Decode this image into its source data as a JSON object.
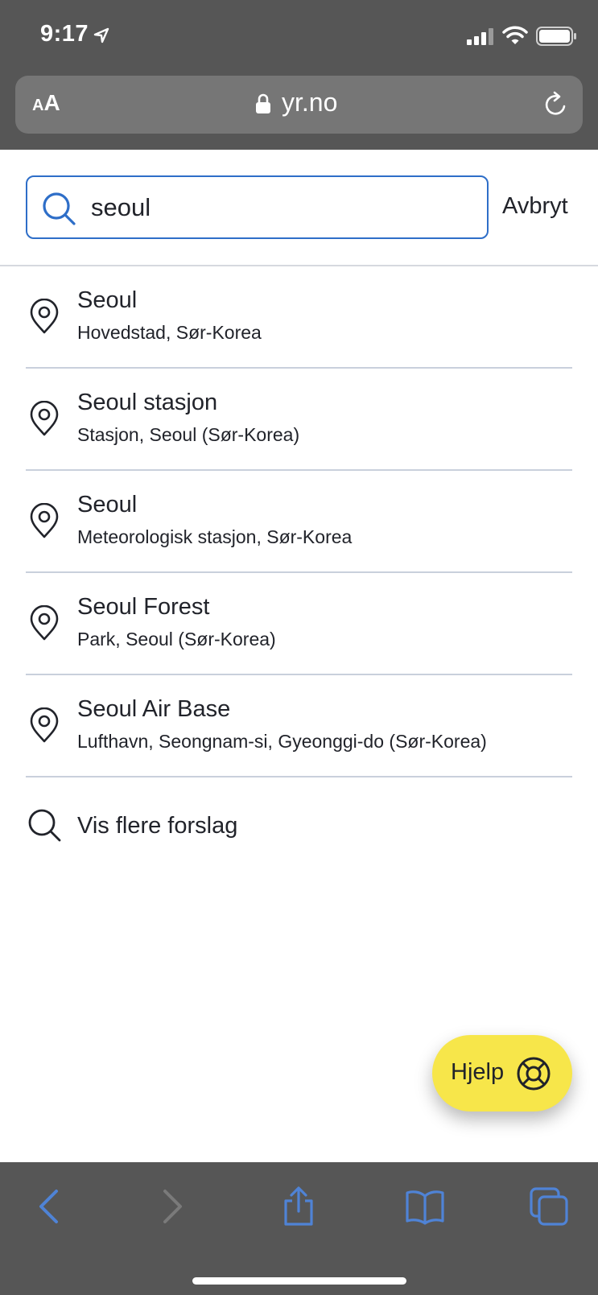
{
  "status_bar": {
    "time": "9:17"
  },
  "browser": {
    "text_size_small": "A",
    "text_size_big": "A",
    "url": "yr.no"
  },
  "search": {
    "value": "seoul",
    "cancel_label": "Avbryt"
  },
  "results": [
    {
      "title": "Seoul",
      "subtitle": "Hovedstad, Sør-Korea"
    },
    {
      "title": "Seoul stasjon",
      "subtitle": "Stasjon, Seoul (Sør-Korea)"
    },
    {
      "title": "Seoul",
      "subtitle": "Meteorologisk stasjon, Sør-Korea"
    },
    {
      "title": "Seoul Forest",
      "subtitle": "Park, Seoul (Sør-Korea)"
    },
    {
      "title": "Seoul Air Base",
      "subtitle": "Lufthavn, Seongnam-si, Gyeonggi-do (Sør-Korea)"
    }
  ],
  "more_suggestions_label": "Vis flere forslag",
  "help_label": "Hjelp",
  "colors": {
    "chrome": "#565656",
    "accent": "#2e6ec8",
    "help_button": "#f7e64a",
    "toolbar_icon": "#4f83d6"
  },
  "icons": {
    "status": [
      "location-arrow-icon",
      "cellular-signal-icon",
      "wifi-icon",
      "battery-icon"
    ],
    "browser": [
      "lock-icon",
      "reload-icon"
    ],
    "search": "search-icon",
    "result": "location-pin-icon",
    "help": "lifebuoy-icon",
    "toolbar": [
      "back-icon",
      "forward-icon",
      "share-icon",
      "bookmarks-icon",
      "tabs-icon"
    ]
  }
}
